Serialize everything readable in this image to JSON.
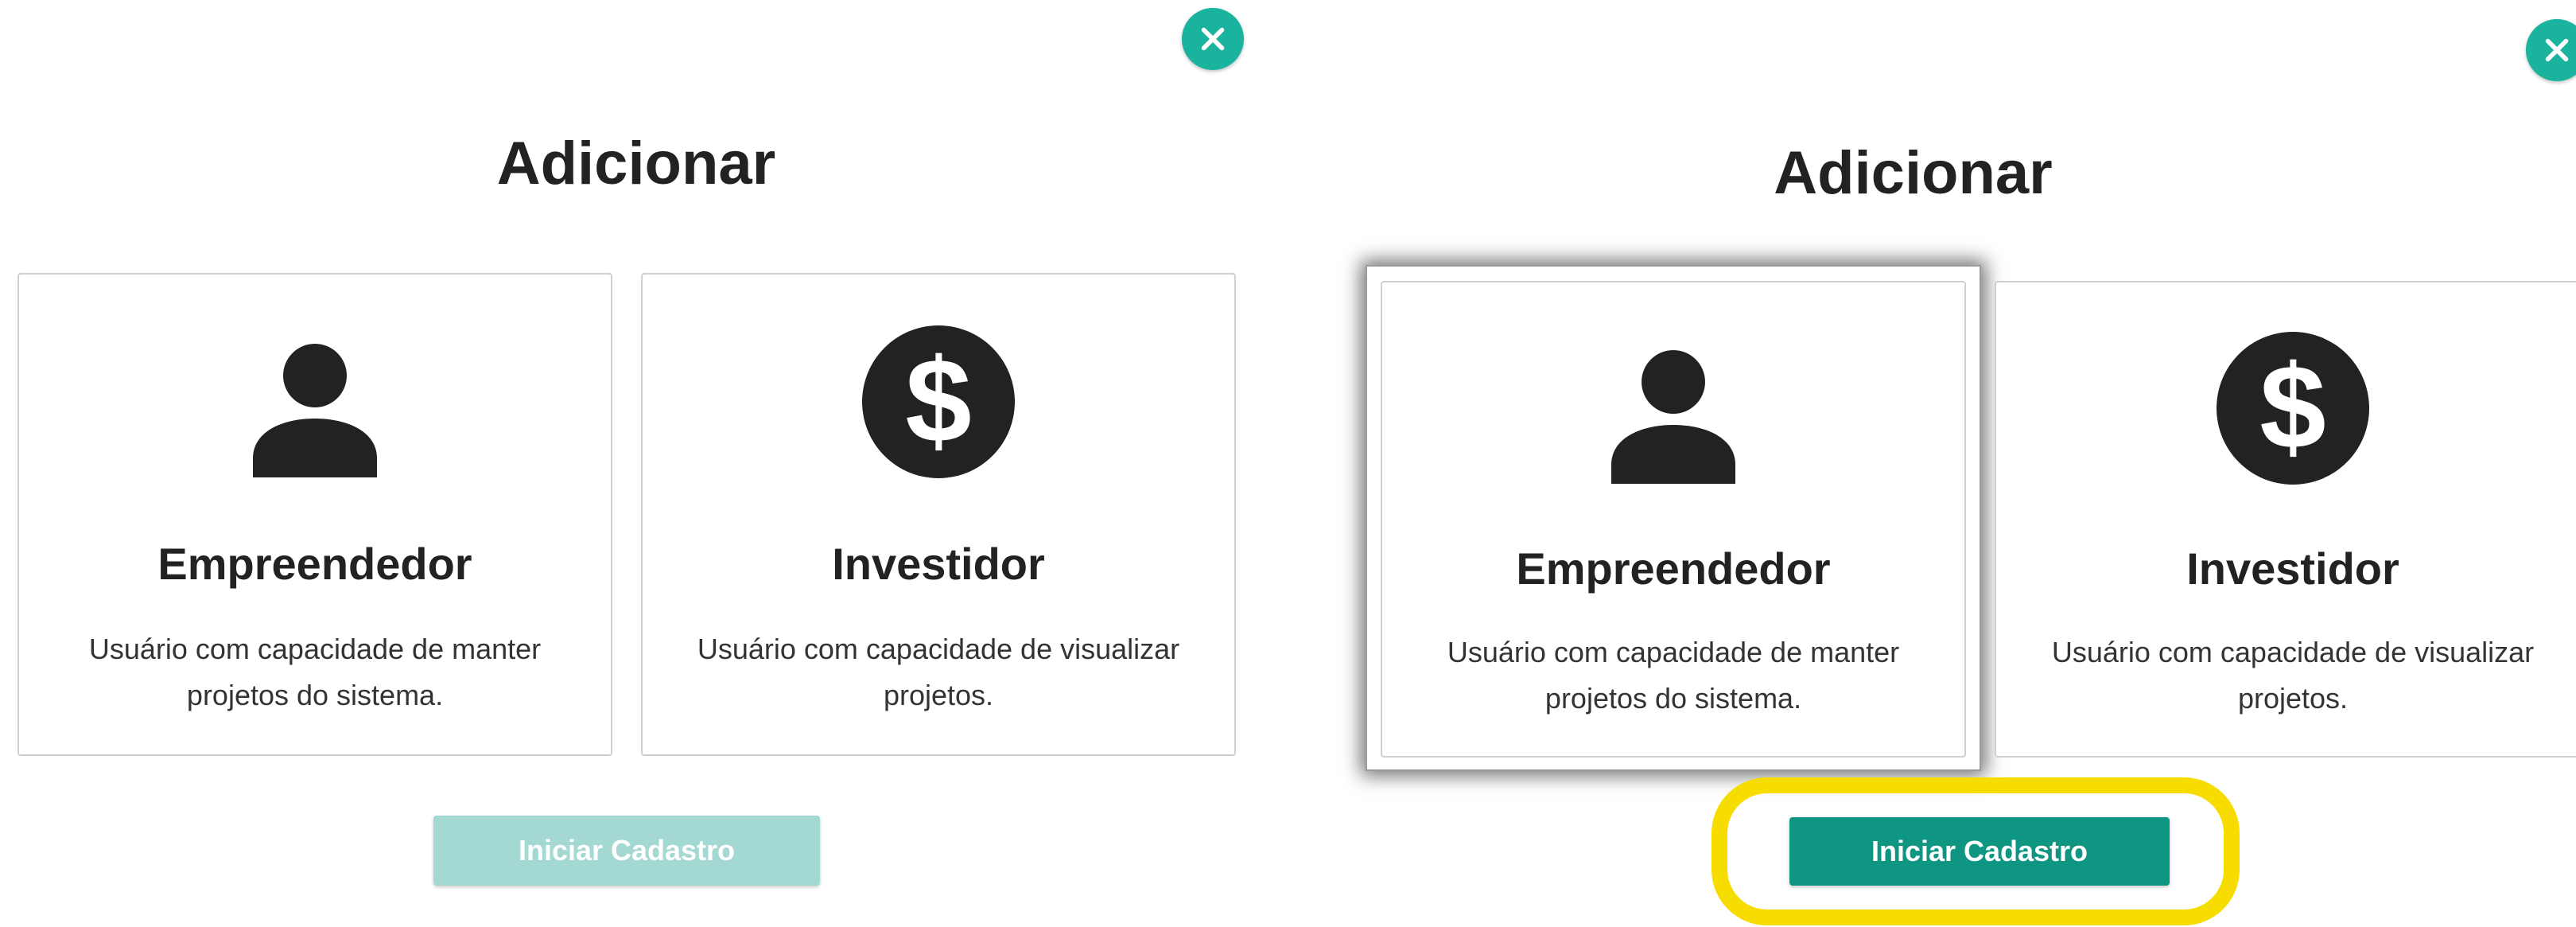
{
  "panels": [
    {
      "title": "Adicionar",
      "cards": [
        {
          "icon": "person-icon",
          "name": "Empreendedor",
          "desc": "Usuário com capacidade de manter projetos do sistema."
        },
        {
          "icon": "dollar-icon",
          "name": "Investidor",
          "desc": "Usuário com capacidade de visualizar projetos."
        }
      ],
      "button_label": "Iniciar Cadastro",
      "button_state": "disabled"
    },
    {
      "title": "Adicionar",
      "cards": [
        {
          "icon": "person-icon",
          "name": "Empreendedor",
          "desc": "Usuário com capacidade de manter projetos do sistema.",
          "selected": true
        },
        {
          "icon": "dollar-icon",
          "name": "Investidor",
          "desc": "Usuário com capacidade de visualizar projetos."
        }
      ],
      "button_label": "Iniciar Cadastro",
      "button_state": "enabled"
    }
  ],
  "colors": {
    "accent": "#19b39e",
    "button_enabled": "#0f9682",
    "button_disabled": "#a3d9d2",
    "highlight": "#f7dc00",
    "icon": "#222222"
  }
}
